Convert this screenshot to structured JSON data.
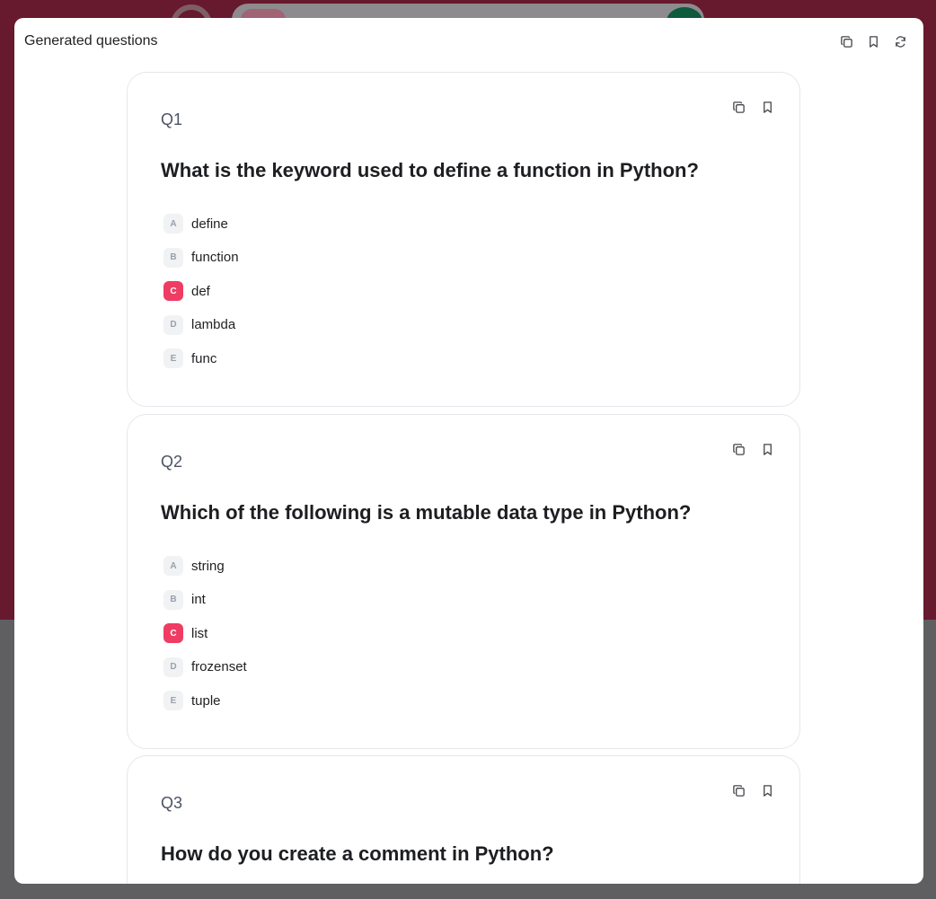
{
  "modal": {
    "title": "Generated questions",
    "icons": [
      "copy-icon",
      "bookmark-icon",
      "refresh-icon"
    ]
  },
  "colors": {
    "accent": "#ef3c63",
    "background_brand": "#67192e"
  },
  "questions": [
    {
      "number": "Q1",
      "text": "What is the keyword used to define a function in Python?",
      "options": [
        {
          "letter": "A",
          "text": "define",
          "correct": false
        },
        {
          "letter": "B",
          "text": "function",
          "correct": false
        },
        {
          "letter": "C",
          "text": "def",
          "correct": true
        },
        {
          "letter": "D",
          "text": "lambda",
          "correct": false
        },
        {
          "letter": "E",
          "text": "func",
          "correct": false
        }
      ]
    },
    {
      "number": "Q2",
      "text": "Which of the following is a mutable data type in Python?",
      "options": [
        {
          "letter": "A",
          "text": "string",
          "correct": false
        },
        {
          "letter": "B",
          "text": "int",
          "correct": false
        },
        {
          "letter": "C",
          "text": "list",
          "correct": true
        },
        {
          "letter": "D",
          "text": "frozenset",
          "correct": false
        },
        {
          "letter": "E",
          "text": "tuple",
          "correct": false
        }
      ]
    },
    {
      "number": "Q3",
      "text": "How do you create a comment in Python?",
      "options": []
    }
  ]
}
